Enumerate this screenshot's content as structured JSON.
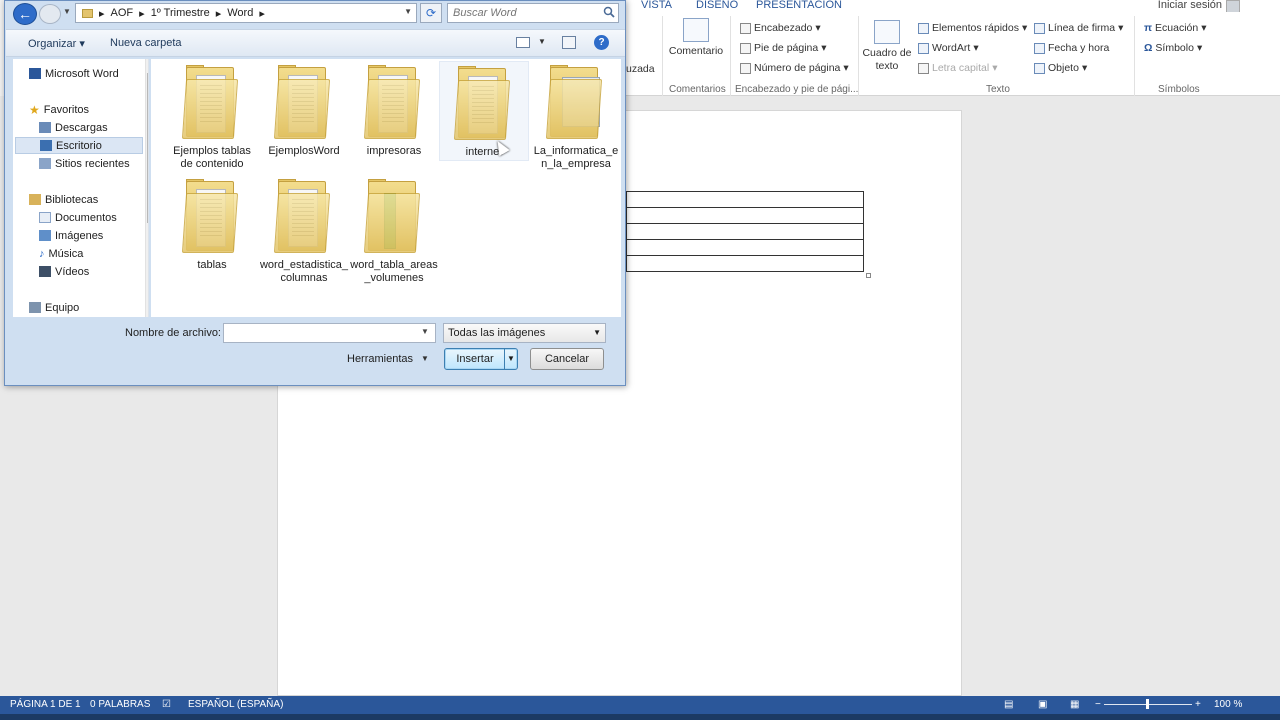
{
  "word": {
    "tabs": [
      "VISTA",
      "DISEÑO",
      "PRESENTACIÓN"
    ],
    "login": "Iniciar sesión",
    "ribbon": {
      "partial_left": "uzada",
      "comment_button": "Comentario",
      "comments_group": "Comentarios",
      "header_items": [
        "Encabezado",
        "Pie de página",
        "Número de página"
      ],
      "header_group": "Encabezado y pie de pági...",
      "textbox_button": [
        "Cuadro de",
        "texto"
      ],
      "text_items_col1": [
        "Elementos rápidos",
        "WordArt",
        "Letra capital"
      ],
      "text_items_col2": [
        "Línea de firma",
        "Fecha y hora",
        "Objeto"
      ],
      "text_group": "Texto",
      "symbol_items": [
        "Ecuación",
        "Símbolo"
      ],
      "symbols_group": "Símbolos"
    },
    "statusbar": {
      "page": "PÁGINA 1 DE 1",
      "words": "0 PALABRAS",
      "language": "ESPAÑOL (ESPAÑA)",
      "zoom": "100 %",
      "zoom_minus": "−",
      "zoom_plus": "+"
    }
  },
  "dialog": {
    "address": [
      "AOF",
      "1º Trimestre",
      "Word"
    ],
    "search_placeholder": "Buscar Word",
    "toolbar": {
      "organize": "Organizar",
      "new_folder": "Nueva carpeta",
      "help": "?"
    },
    "sidebar": [
      {
        "label": "Microsoft Word",
        "icon": "word-icon"
      },
      {
        "label": "Favoritos",
        "icon": "star-icon"
      },
      {
        "label": "Descargas",
        "icon": "downloads-icon"
      },
      {
        "label": "Escritorio",
        "icon": "desktop-icon"
      },
      {
        "label": "Sitios recientes",
        "icon": "recent-icon"
      },
      {
        "label": "Bibliotecas",
        "icon": "library-icon"
      },
      {
        "label": "Documentos",
        "icon": "documents-icon"
      },
      {
        "label": "Imágenes",
        "icon": "images-icon"
      },
      {
        "label": "Música",
        "icon": "music-icon"
      },
      {
        "label": "Vídeos",
        "icon": "videos-icon"
      },
      {
        "label": "Equipo",
        "icon": "computer-icon"
      }
    ],
    "files": [
      {
        "line1": "Ejemplos tablas",
        "line2": "de contenido",
        "style": "doc"
      },
      {
        "line1": "EjemplosWord",
        "line2": "",
        "style": "doc"
      },
      {
        "line1": "impresoras",
        "line2": "",
        "style": "doc"
      },
      {
        "line1": "internet",
        "line2": "",
        "style": "doc"
      },
      {
        "line1": "La_informatica_e",
        "line2": "n_la_empresa",
        "style": "slide"
      },
      {
        "line1": "tablas",
        "line2": "",
        "style": "doc"
      },
      {
        "line1": "word_estadistica_",
        "line2": "columnas",
        "style": "doc"
      },
      {
        "line1": "word_tabla_areas",
        "line2": "_volumenes",
        "style": "green"
      }
    ],
    "filename_label": "Nombre de archivo:",
    "filename_value": "",
    "filter": "Todas las imágenes",
    "tools": "Herramientas",
    "insert": "Insertar",
    "cancel": "Cancelar"
  }
}
